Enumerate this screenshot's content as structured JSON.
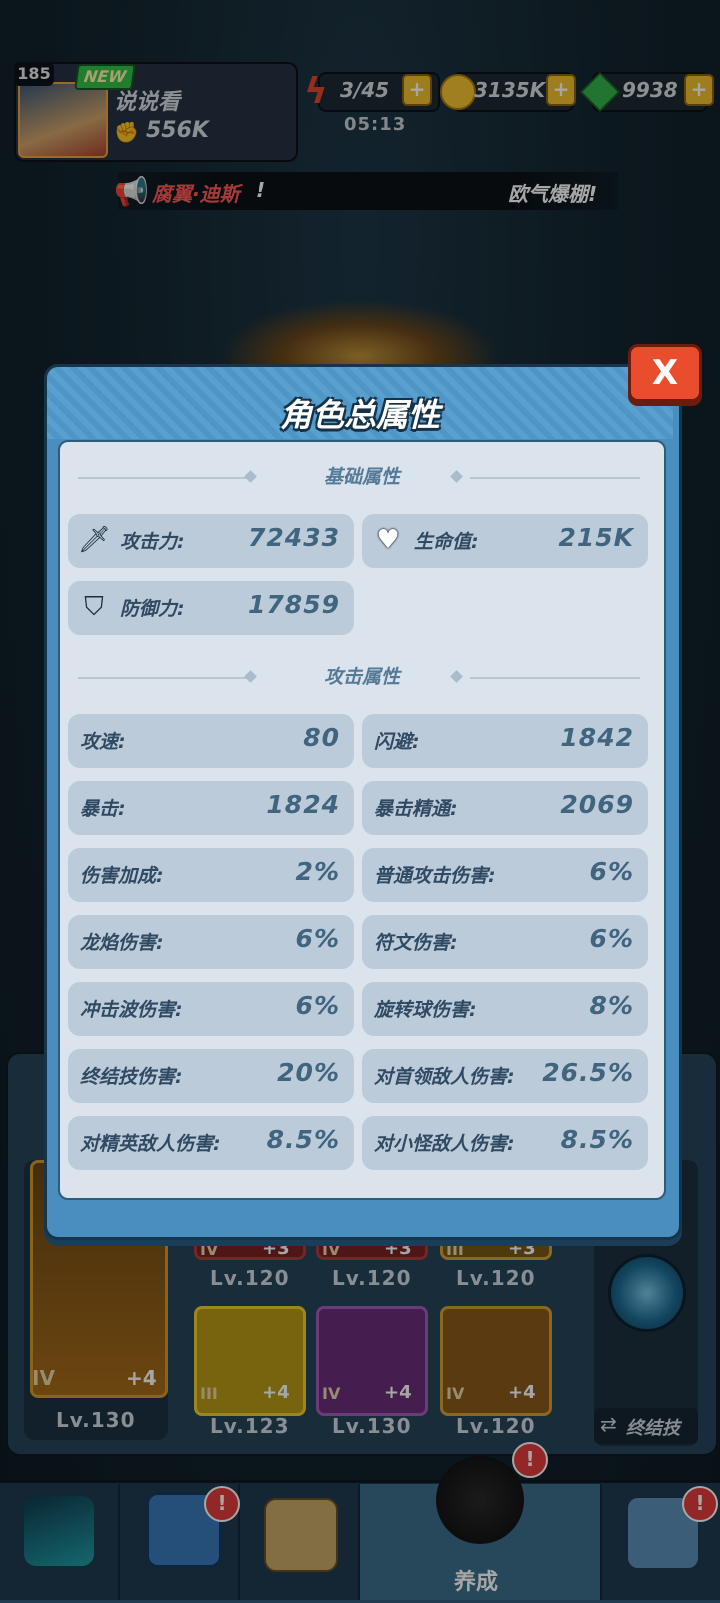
{
  "player": {
    "level": "185",
    "new_badge": "NEW",
    "name": "说说看",
    "power": "556K"
  },
  "resources": {
    "energy": "3/45",
    "energy_timer": "05:13",
    "coins": "3135K",
    "gems": "9938",
    "plus": "+"
  },
  "announcement": {
    "name": "腐翼·迪斯",
    "bang": "!",
    "message": "欧气爆棚!"
  },
  "modal": {
    "title": "角色总属性",
    "close": "X",
    "sections": {
      "basic": "基础属性",
      "attack": "攻击属性"
    },
    "basic_stats": [
      {
        "label": "攻击力:",
        "value": "72433",
        "icon": "sword-icon"
      },
      {
        "label": "生命值:",
        "value": "215K",
        "icon": "heart-icon"
      },
      {
        "label": "防御力:",
        "value": "17859",
        "icon": "shield-icon"
      }
    ],
    "attack_stats": [
      {
        "label": "攻速:",
        "value": "80"
      },
      {
        "label": "闪避:",
        "value": "1842"
      },
      {
        "label": "暴击:",
        "value": "1824"
      },
      {
        "label": "暴击精通:",
        "value": "2069"
      },
      {
        "label": "伤害加成:",
        "value": "2%"
      },
      {
        "label": "普通攻击伤害:",
        "value": "6%"
      },
      {
        "label": "龙焰伤害:",
        "value": "6%"
      },
      {
        "label": "符文伤害:",
        "value": "6%"
      },
      {
        "label": "冲击波伤害:",
        "value": "6%"
      },
      {
        "label": "旋转球伤害:",
        "value": "8%"
      },
      {
        "label": "终结技伤害:",
        "value": "20%"
      },
      {
        "label": "对首领敌人伤害:",
        "value": "26.5%"
      },
      {
        "label": "对精英敌人伤害:",
        "value": "8.5%"
      },
      {
        "label": "对小怪敌人伤害:",
        "value": "8.5%"
      }
    ]
  },
  "equipment": {
    "weapon": {
      "tier": "IV",
      "plus": "+4",
      "level": "Lv.130"
    },
    "slots_top": [
      {
        "tier": "IV",
        "plus": "+3",
        "level": "Lv.120"
      },
      {
        "tier": "IV",
        "plus": "+3",
        "level": "Lv.120"
      },
      {
        "tier": "III",
        "plus": "+3",
        "level": "Lv.120"
      }
    ],
    "slots_bottom": [
      {
        "tier": "III",
        "plus": "+4",
        "level": "Lv.123"
      },
      {
        "tier": "IV",
        "plus": "+4",
        "level": "Lv.130"
      },
      {
        "tier": "IV",
        "plus": "+4",
        "level": "Lv.120"
      }
    ],
    "finisher_label": "终结技"
  },
  "nav": {
    "active_label": "养成",
    "alert": "!"
  },
  "colors": {
    "accent_blue": "#4a8ec0",
    "close_red": "#e94d2e",
    "value_blue": "#41647f",
    "alert_red": "#e23b3b"
  }
}
